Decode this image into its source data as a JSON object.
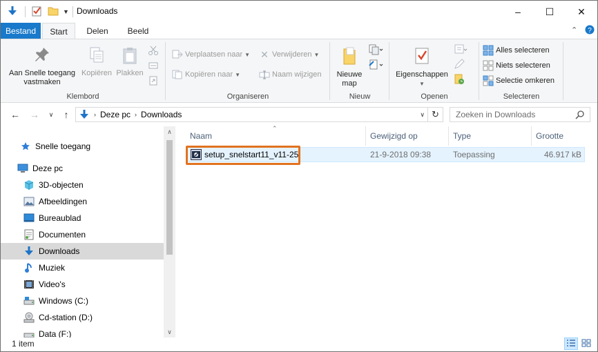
{
  "window": {
    "title": "Downloads",
    "controls": {
      "minimize": "–",
      "maximize": "☐",
      "close": "✕"
    }
  },
  "ribbon_tabs": [
    {
      "label": "Bestand"
    },
    {
      "label": "Start"
    },
    {
      "label": "Delen"
    },
    {
      "label": "Beeld"
    }
  ],
  "ribbon": {
    "klembord": {
      "label": "Klembord",
      "pin_label_1": "Aan Snelle toegang",
      "pin_label_2": "vastmaken",
      "copy_label": "Kopiëren",
      "paste_label": "Plakken"
    },
    "organiseren": {
      "label": "Organiseren",
      "move_label": "Verplaatsen naar",
      "copy_to_label": "Kopiëren naar",
      "delete_label": "Verwijderen",
      "rename_label": "Naam wijzigen"
    },
    "nieuw": {
      "label": "Nieuw",
      "new_folder_1": "Nieuwe",
      "new_folder_2": "map"
    },
    "openen": {
      "label": "Openen",
      "properties_label": "Eigenschappen"
    },
    "selecteren": {
      "label": "Selecteren",
      "select_all": "Alles selecteren",
      "select_none": "Niets selecteren",
      "invert": "Selectie omkeren"
    }
  },
  "address": {
    "crumbs": [
      "Deze pc",
      "Downloads"
    ],
    "search_placeholder": "Zoeken in Downloads"
  },
  "sidebar": {
    "items": [
      {
        "label": "Snelle toegang",
        "icon": "star-icon"
      },
      {
        "label": "Deze pc",
        "icon": "computer-icon"
      },
      {
        "label": "3D-objecten",
        "icon": "cube-icon"
      },
      {
        "label": "Afbeeldingen",
        "icon": "pictures-icon"
      },
      {
        "label": "Bureaublad",
        "icon": "desktop-icon"
      },
      {
        "label": "Documenten",
        "icon": "documents-icon"
      },
      {
        "label": "Downloads",
        "icon": "download-icon",
        "selected": true
      },
      {
        "label": "Muziek",
        "icon": "music-icon"
      },
      {
        "label": "Video's",
        "icon": "video-icon"
      },
      {
        "label": "Windows (C:)",
        "icon": "drive-icon"
      },
      {
        "label": "Cd-station (D:)",
        "icon": "cd-drive-icon"
      },
      {
        "label": "Data (F:)",
        "icon": "drive-icon"
      }
    ]
  },
  "filelist": {
    "columns": [
      "Naam",
      "Gewijzigd op",
      "Type",
      "Grootte"
    ],
    "rows": [
      {
        "name": "setup_snelstart11_v11-25",
        "modified": "21-9-2018 09:38",
        "type": "Toepassing",
        "size": "46.917 kB"
      }
    ]
  },
  "status": {
    "count": "1 item"
  },
  "colors": {
    "accent": "#1979ca",
    "highlight_border": "#e2721f",
    "selection_bg": "#e5f3ff"
  }
}
